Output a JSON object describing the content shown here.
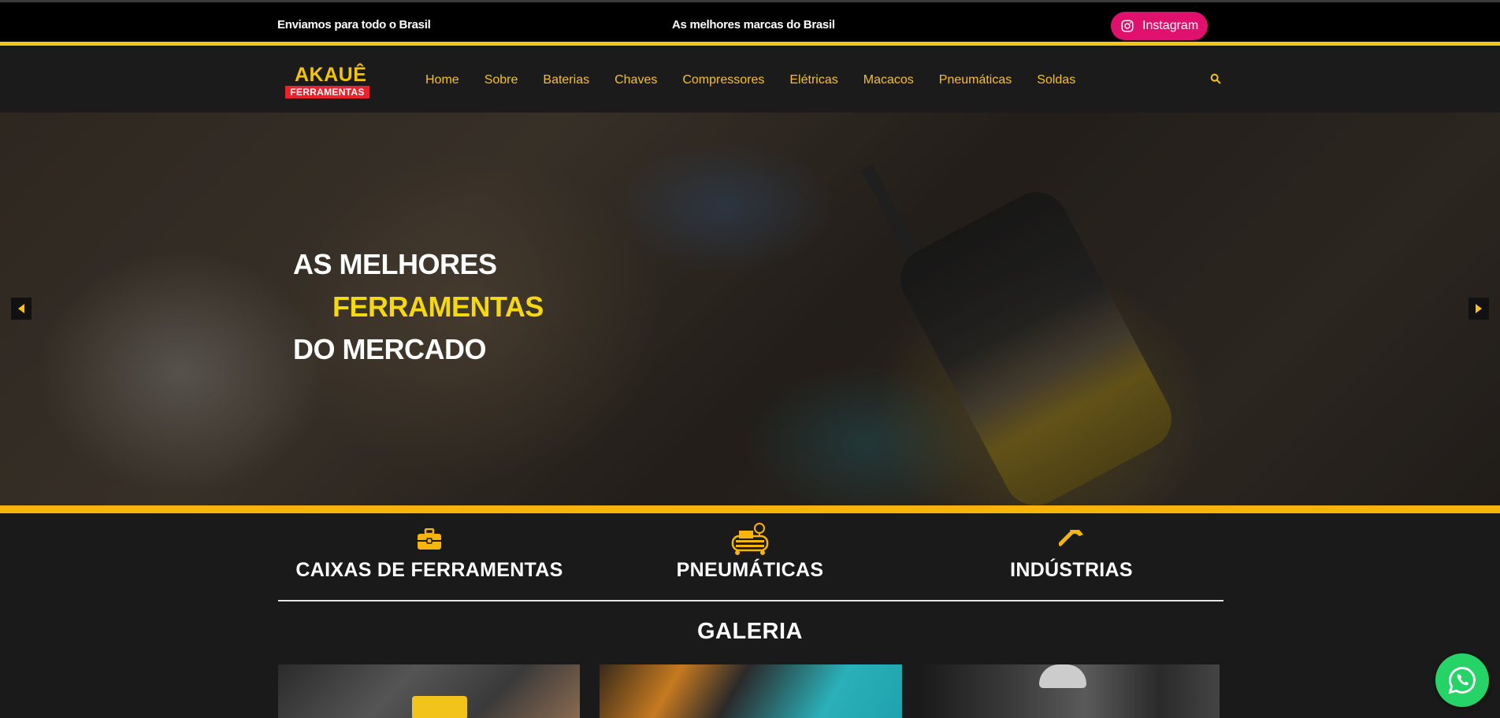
{
  "topbar": {
    "left_text": "Enviamos para todo o Brasil",
    "center_text": "As melhores marcas do Brasil",
    "instagram_label": "Instagram"
  },
  "logo": {
    "name": "AKAUÊ",
    "tagline": "FERRAMENTAS"
  },
  "nav": {
    "items": [
      "Home",
      "Sobre",
      "Baterias",
      "Chaves",
      "Compressores",
      "Elétricas",
      "Macacos",
      "Pneumáticas",
      "Soldas"
    ],
    "search_icon": "search-icon"
  },
  "hero": {
    "line1": "AS MELHORES",
    "line2": "FERRAMENTAS",
    "line3": "DO MERCADO",
    "prev_icon": "arrow-left-icon",
    "next_icon": "arrow-right-icon"
  },
  "features": [
    {
      "label": "CAIXAS DE FERRAMENTAS",
      "icon": "toolbox-icon"
    },
    {
      "label": "PNEUMÁTICAS",
      "icon": "compressor-icon"
    },
    {
      "label": "INDÚSTRIAS",
      "icon": "hammer-icon"
    }
  ],
  "gallery": {
    "title": "GALERIA"
  },
  "colors": {
    "accent": "#f7c21a",
    "instagram": "#e0106f",
    "whatsapp": "#25d366",
    "logo_red": "#e8232a"
  }
}
